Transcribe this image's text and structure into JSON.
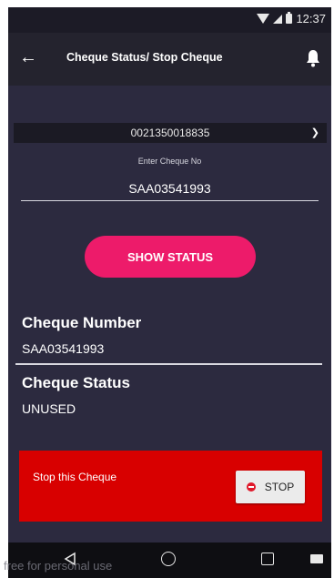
{
  "status_bar": {
    "time": "12:37"
  },
  "app_bar": {
    "title": "Cheque Status/ Stop Cheque"
  },
  "form": {
    "account_number": "0021350018835",
    "cheque_field_label": "Enter Cheque No",
    "cheque_field_value": "SAA03541993",
    "show_status_label": "SHOW STATUS"
  },
  "result": {
    "number_heading": "Cheque Number",
    "number_value": "SAA03541993",
    "status_heading": "Cheque Status",
    "status_value": "UNUSED"
  },
  "stop_panel": {
    "label": "Stop this Cheque",
    "button_label": "STOP"
  },
  "watermark": "free for personal use",
  "colors": {
    "background": "#2c2a3f",
    "app_bar": "#24232e",
    "accent_button": "#ed1b6a",
    "stop_panel": "#d80000"
  },
  "icons": {
    "back": "arrow-left-icon",
    "notifications": "bell-icon",
    "dropdown": "chevron-down-icon",
    "stop": "stop-circle-icon"
  }
}
